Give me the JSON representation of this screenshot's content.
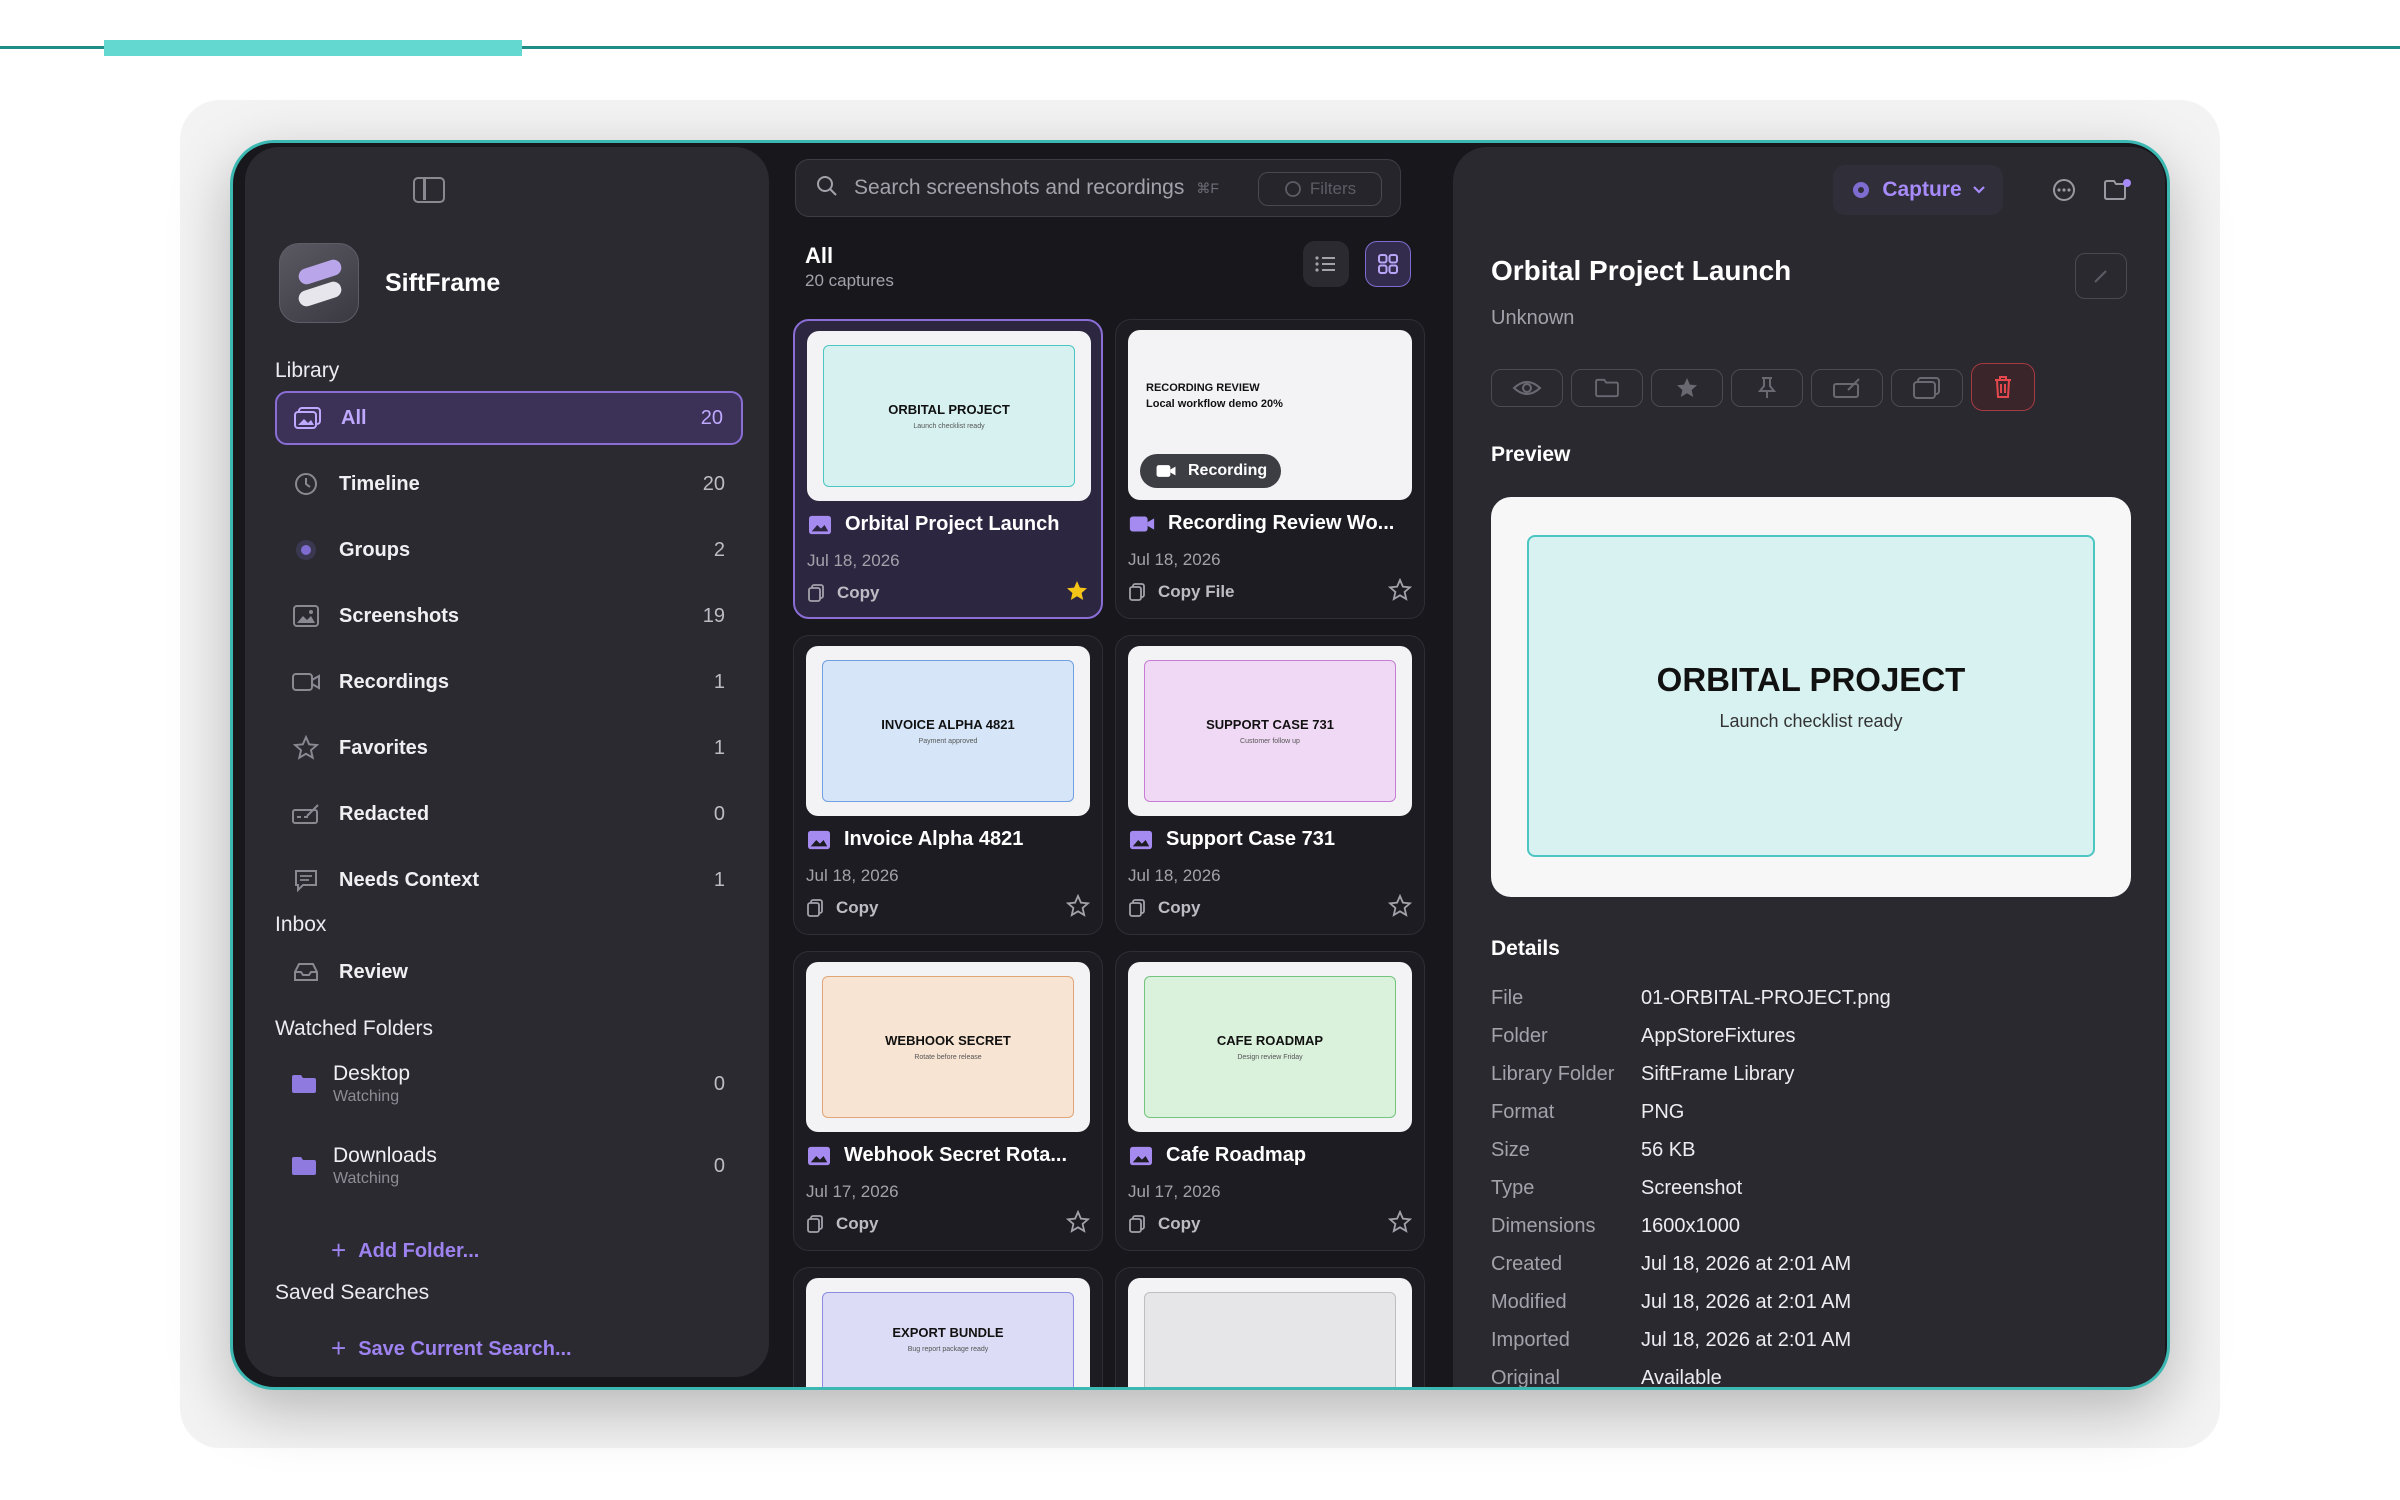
{
  "sidebar": {
    "app_name": "SiftFrame",
    "library_heading": "Library",
    "items": [
      {
        "label": "All",
        "count": "20"
      },
      {
        "label": "Timeline",
        "count": "20"
      },
      {
        "label": "Groups",
        "count": "2"
      },
      {
        "label": "Screenshots",
        "count": "19"
      },
      {
        "label": "Recordings",
        "count": "1"
      },
      {
        "label": "Favorites",
        "count": "1"
      },
      {
        "label": "Redacted",
        "count": "0"
      },
      {
        "label": "Needs Context",
        "count": "1"
      }
    ],
    "inbox_heading": "Inbox",
    "inbox_item": "Review",
    "watched_heading": "Watched Folders",
    "folders": [
      {
        "name": "Desktop",
        "status": "Watching",
        "count": "0"
      },
      {
        "name": "Downloads",
        "status": "Watching",
        "count": "0"
      }
    ],
    "add_folder": "Add Folder...",
    "saved_heading": "Saved Searches",
    "save_search": "Save Current Search..."
  },
  "center": {
    "search_placeholder": "Search screenshots and recordings",
    "search_shortcut": "⌘F",
    "filters_label": "Filters",
    "title": "All",
    "subtitle": "20 captures",
    "cards": [
      {
        "title": "Orbital Project Launch",
        "date": "Jul 18, 2026",
        "action": "Copy",
        "thumb_title": "ORBITAL PROJECT",
        "thumb_sub": "Launch checklist ready",
        "favorite": true
      },
      {
        "title": "Recording Review Wo...",
        "date": "Jul 18, 2026",
        "action": "Copy File",
        "thumb_title": "RECORDING REVIEW",
        "thumb_sub": "Local workflow demo 20%",
        "badge": "Recording",
        "favorite": false
      },
      {
        "title": "Invoice Alpha 4821",
        "date": "Jul 18, 2026",
        "action": "Copy",
        "thumb_title": "INVOICE ALPHA 4821",
        "thumb_sub": "Payment approved",
        "favorite": false
      },
      {
        "title": "Support Case 731",
        "date": "Jul 18, 2026",
        "action": "Copy",
        "thumb_title": "SUPPORT CASE 731",
        "thumb_sub": "Customer follow up",
        "favorite": false
      },
      {
        "title": "Webhook Secret Rota...",
        "date": "Jul 17, 2026",
        "action": "Copy",
        "thumb_title": "WEBHOOK SECRET",
        "thumb_sub": "Rotate before release",
        "favorite": false
      },
      {
        "title": "Cafe Roadmap",
        "date": "Jul 17, 2026",
        "action": "Copy",
        "thumb_title": "CAFE ROADMAP",
        "thumb_sub": "Design review Friday",
        "favorite": false
      },
      {
        "thumb_title": "EXPORT BUNDLE",
        "thumb_sub": "Bug report package ready"
      },
      {
        "thumb_title": "",
        "thumb_sub": ""
      }
    ]
  },
  "detail": {
    "capture_label": "Capture",
    "title": "Orbital Project Launch",
    "subtitle": "Unknown",
    "preview_heading": "Preview",
    "preview_title": "ORBITAL PROJECT",
    "preview_sub": "Launch checklist ready",
    "details_heading": "Details",
    "rows": [
      {
        "k": "File",
        "v": "01-ORBITAL-PROJECT.png"
      },
      {
        "k": "Folder",
        "v": "AppStoreFixtures"
      },
      {
        "k": "Library Folder",
        "v": "SiftFrame Library"
      },
      {
        "k": "Format",
        "v": "PNG"
      },
      {
        "k": "Size",
        "v": "56 KB"
      },
      {
        "k": "Type",
        "v": "Screenshot"
      },
      {
        "k": "Dimensions",
        "v": "1600x1000"
      },
      {
        "k": "Created",
        "v": "Jul 18, 2026 at 2:01 AM"
      },
      {
        "k": "Modified",
        "v": "Jul 18, 2026 at 2:01 AM"
      },
      {
        "k": "Imported",
        "v": "Jul 18, 2026 at 2:01 AM"
      },
      {
        "k": "Original",
        "v": "Available"
      }
    ]
  },
  "colors": {
    "accent": "#8a6ed6",
    "teal": "#3bb8b2",
    "star": "#f5c518",
    "delete": "#e5484d"
  },
  "icons": [
    "sidebar-toggle-icon",
    "gallery-icon",
    "clock-icon",
    "circle-icon",
    "image-icon",
    "video-icon",
    "star-icon",
    "redact-icon",
    "comment-icon",
    "tray-icon",
    "folder-icon",
    "plus-icon",
    "search-icon",
    "list-icon",
    "grid-icon",
    "copy-icon",
    "crosshair-icon",
    "chevron-down-icon",
    "ellipsis-icon",
    "folder-badge-icon",
    "pencil-icon",
    "eye-icon",
    "pin-icon",
    "trash-icon"
  ]
}
